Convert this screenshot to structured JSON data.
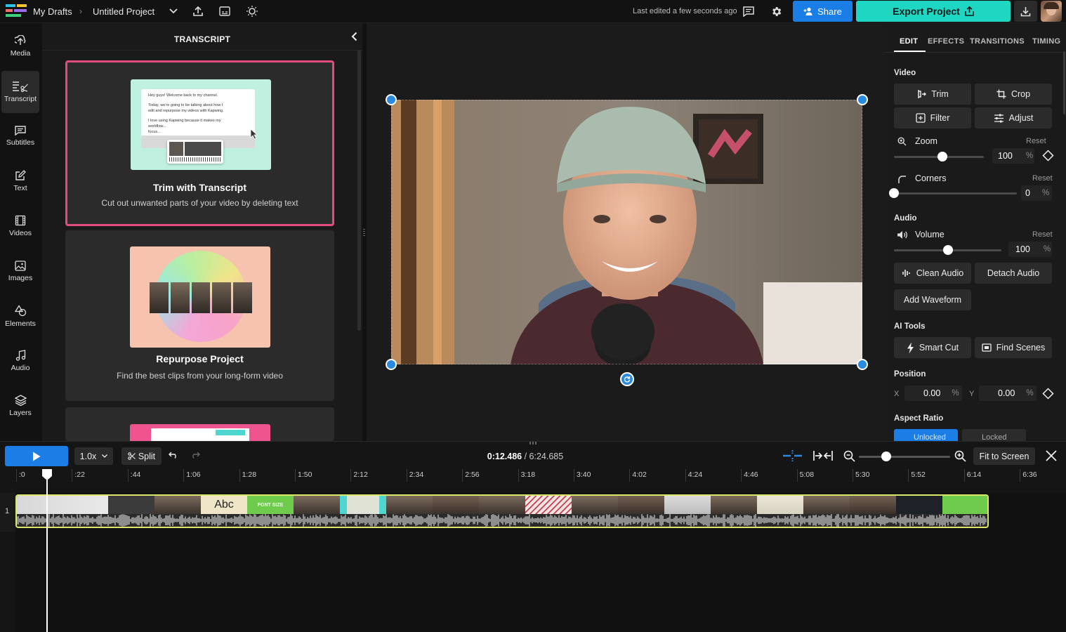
{
  "topbar": {
    "breadcrumb_root": "My Drafts",
    "project_name": "Untitled Project",
    "last_edited": "Last edited a few seconds ago",
    "share_label": "Share",
    "export_label": "Export Project",
    "icons": [
      "logo-icon",
      "chevron-right-icon",
      "chevron-down-icon",
      "upload-icon",
      "subtitle-icon",
      "lightbulb-icon",
      "comment-icon",
      "gear-icon",
      "add-user-icon",
      "export-icon",
      "download-icon"
    ]
  },
  "nav": {
    "items": [
      {
        "label": "Media",
        "icon": "upload-media-icon"
      },
      {
        "label": "Transcript",
        "icon": "transcript-icon"
      },
      {
        "label": "Subtitles",
        "icon": "subtitles-icon"
      },
      {
        "label": "Text",
        "icon": "text-edit-icon"
      },
      {
        "label": "Videos",
        "icon": "film-icon"
      },
      {
        "label": "Images",
        "icon": "image-icon"
      },
      {
        "label": "Elements",
        "icon": "shapes-icon"
      },
      {
        "label": "Audio",
        "icon": "music-note-icon"
      },
      {
        "label": "Layers",
        "icon": "layers-icon"
      }
    ],
    "active": "Transcript"
  },
  "transcript_panel": {
    "title": "TRANSCRIPT",
    "cards": [
      {
        "title": "Trim with Transcript",
        "description": "Cut out unwanted parts of your video by deleting text",
        "preview_lines": [
          "Hey guys! Welcome back to my channel.",
          "Today, we're going to be talking about how I",
          "edit and repurpose my videos with Kapwing.",
          "I love using Kapwing because it makes my",
          "workflow...",
          "focus..."
        ]
      },
      {
        "title": "Repurpose Project",
        "description": "Find the best clips from your long-form video"
      }
    ]
  },
  "editor": {
    "tabs": [
      "EDIT",
      "EFFECTS",
      "TRANSITIONS",
      "TIMING"
    ],
    "active_tab": "EDIT",
    "video_section": "Video",
    "trim_label": "Trim",
    "crop_label": "Crop",
    "filter_label": "Filter",
    "adjust_label": "Adjust",
    "zoom_label": "Zoom",
    "zoom_value": "100",
    "zoom_unit": "%",
    "reset_label": "Reset",
    "corners_label": "Corners",
    "corners_value": "0",
    "corners_unit": "%",
    "audio_section": "Audio",
    "volume_label": "Volume",
    "volume_value": "100",
    "volume_unit": "%",
    "clean_audio_label": "Clean Audio",
    "detach_audio_label": "Detach Audio",
    "add_waveform_label": "Add Waveform",
    "ai_section": "AI Tools",
    "smart_cut_label": "Smart Cut",
    "find_scenes_label": "Find Scenes",
    "position_section": "Position",
    "x_label": "X",
    "x_value": "0.00",
    "x_unit": "%",
    "y_label": "Y",
    "y_value": "0.00",
    "y_unit": "%",
    "aspect_section": "Aspect Ratio",
    "aspect_options": [
      "Unlocked",
      "Locked"
    ],
    "zoom_level": 0.54,
    "corners_level": 0.0,
    "volume_level": 0.5
  },
  "timeline": {
    "speed": "1.0x",
    "split_label": "Split",
    "current_time": "0:12.486",
    "total_time": "/ 6:24.685",
    "fit_label": "Fit to Screen",
    "track_number": "1",
    "tick_labels": [
      ":0",
      ":22",
      ":44",
      "1:06",
      "1:28",
      "1:50",
      "2:12",
      "2:34",
      "2:56",
      "3:18",
      "3:40",
      "4:02",
      "4:24",
      "4:46",
      "5:08",
      "5:30",
      "5:52",
      "6:14",
      "6:36"
    ],
    "clip_text_abc": "Abc",
    "clip_text_font": "FONT SIZE",
    "zoom_level": 0.3
  },
  "colors": {
    "accent_blue": "#1a7ee6",
    "export_teal": "#1fd6c3",
    "selection_pink": "#e14d80",
    "track_border": "#d9e86a",
    "handle_blue": "#2a8ae0"
  }
}
